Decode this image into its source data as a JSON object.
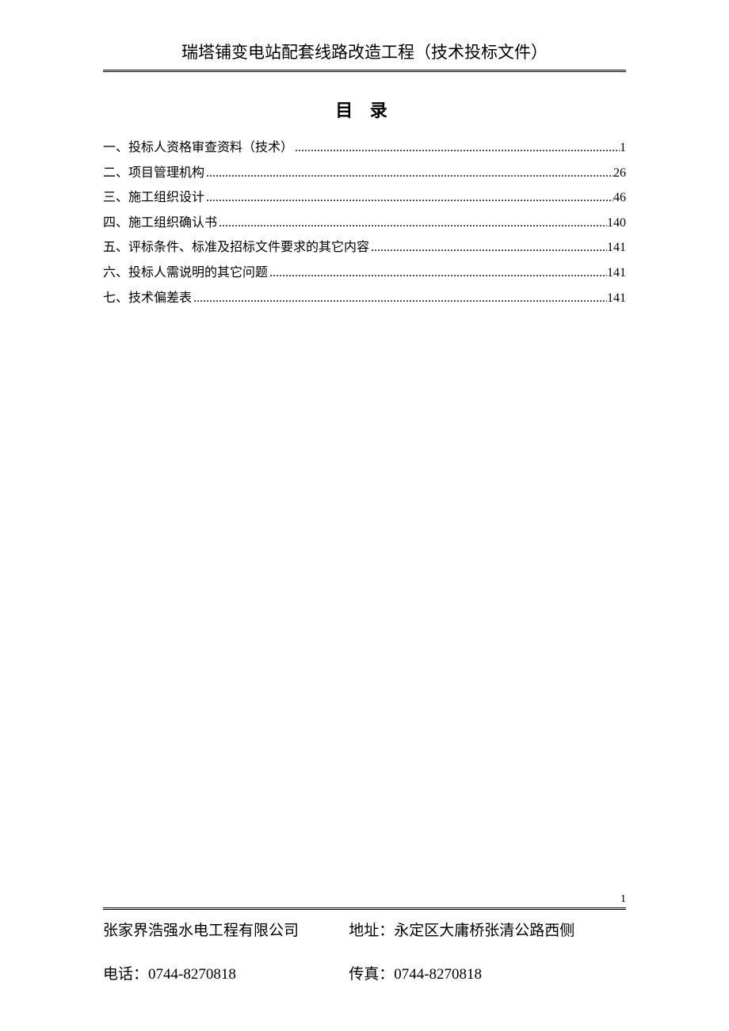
{
  "header": {
    "title": "瑞塔铺变电站配套线路改造工程（技术投标文件）"
  },
  "toc": {
    "title": "目 录",
    "items": [
      {
        "label": "一、投标人资格审查资料（技术）",
        "page": "1"
      },
      {
        "label": "二、项目管理机构",
        "page": "26"
      },
      {
        "label": "三、施工组织设计",
        "page": "46"
      },
      {
        "label": "四、施工组织确认书",
        "page": "140"
      },
      {
        "label": "五、评标条件、标准及招标文件要求的其它内容",
        "page": "141"
      },
      {
        "label": "六、投标人需说明的其它问题",
        "page": "141"
      },
      {
        "label": "七、技术偏差表",
        "page": "141"
      }
    ]
  },
  "page_number": "1",
  "footer": {
    "company": "张家界浩强水电工程有限公司",
    "address_label": "地址：",
    "address": "永定区大庸桥张清公路西侧",
    "phone_label": "电话：",
    "phone": "0744-8270818",
    "fax_label": "传真：",
    "fax": "0744-8270818"
  }
}
